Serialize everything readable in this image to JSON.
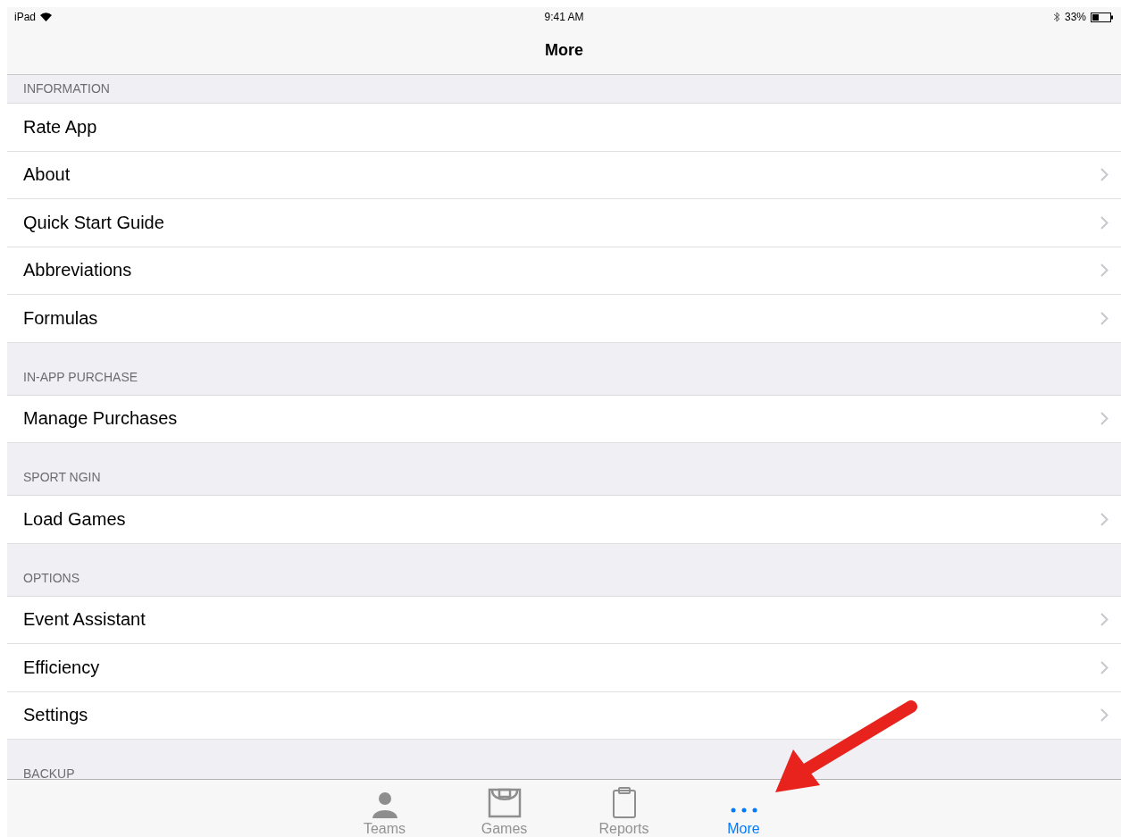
{
  "status_bar": {
    "device": "iPad",
    "time": "9:41 AM",
    "battery": "33%"
  },
  "nav_bar": {
    "title": "More"
  },
  "sections": [
    {
      "header": "INFORMATION",
      "rows": [
        {
          "label": "Rate App",
          "chevron": false
        },
        {
          "label": "About",
          "chevron": true
        },
        {
          "label": "Quick Start Guide",
          "chevron": true
        },
        {
          "label": "Abbreviations",
          "chevron": true
        },
        {
          "label": "Formulas",
          "chevron": true
        }
      ]
    },
    {
      "header": "IN-APP PURCHASE",
      "rows": [
        {
          "label": "Manage Purchases",
          "chevron": true
        }
      ]
    },
    {
      "header": "SPORT NGIN",
      "rows": [
        {
          "label": "Load Games",
          "chevron": true
        }
      ]
    },
    {
      "header": "OPTIONS",
      "rows": [
        {
          "label": "Event Assistant",
          "chevron": true
        },
        {
          "label": "Efficiency",
          "chevron": true
        },
        {
          "label": "Settings",
          "chevron": true
        }
      ]
    },
    {
      "header": "BACKUP"
    }
  ],
  "tab_bar": [
    {
      "kind": "person",
      "label": "Teams",
      "selected": false
    },
    {
      "kind": "court",
      "label": "Games",
      "selected": false
    },
    {
      "kind": "clipboard",
      "label": "Reports",
      "selected": false
    },
    {
      "kind": "dots",
      "label": "More",
      "selected": true
    }
  ]
}
